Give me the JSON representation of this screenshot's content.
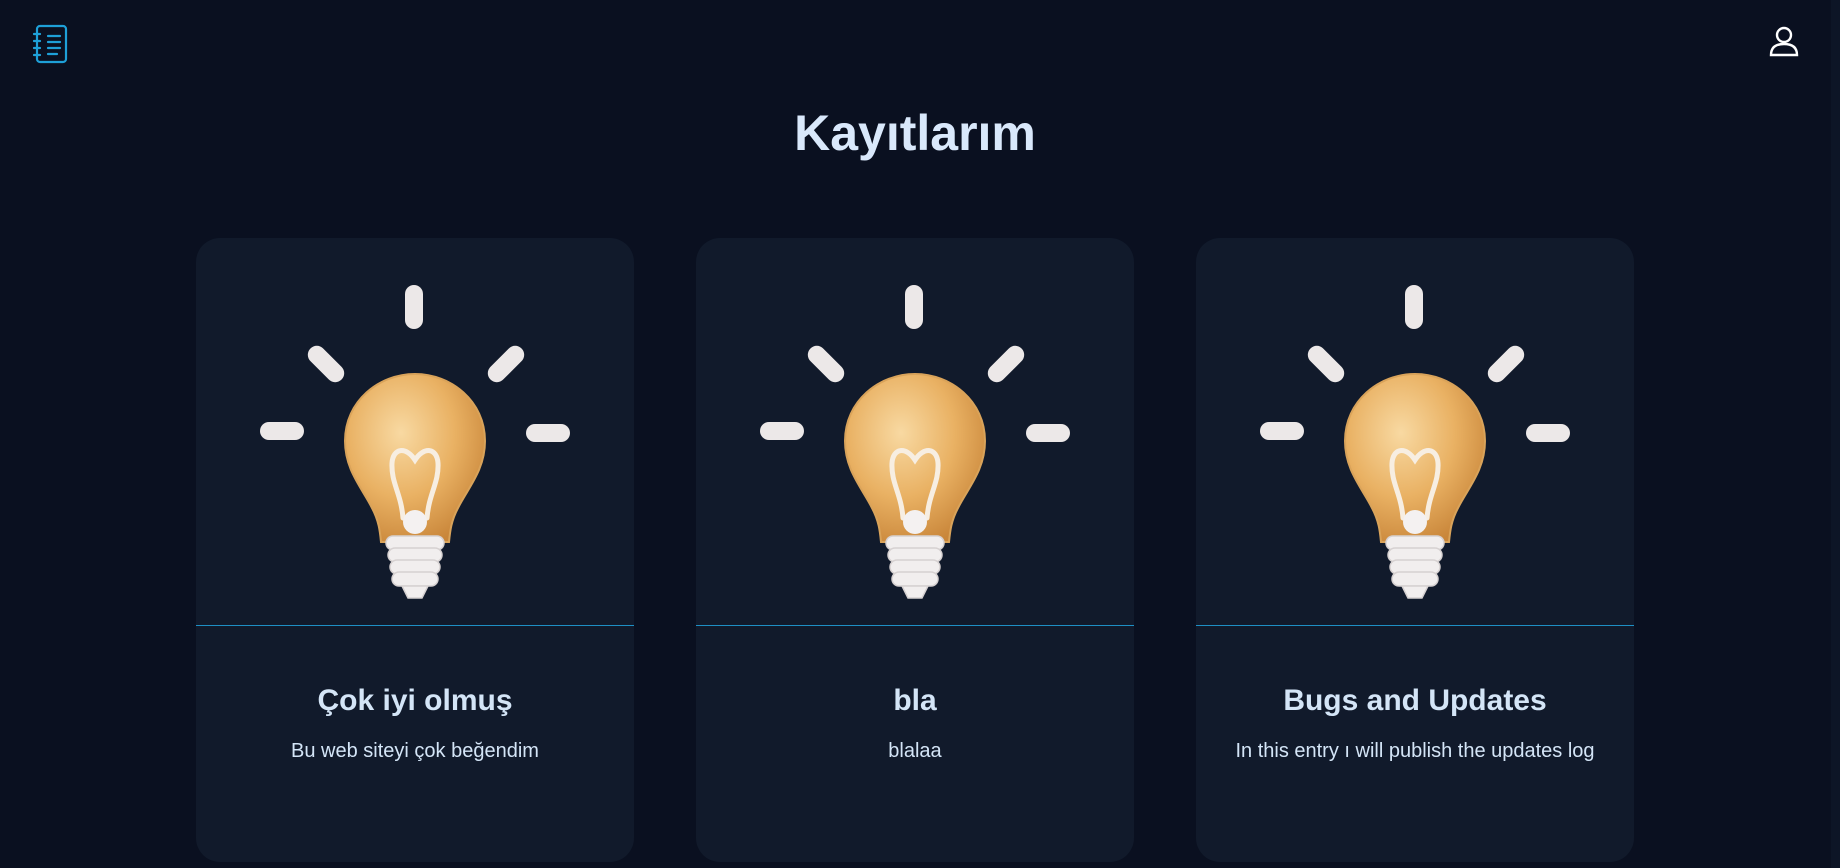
{
  "header": {
    "logo_icon": "notebook-list-icon",
    "profile_icon": "user-profile-icon",
    "accent_color": "#1ea0d8"
  },
  "page": {
    "title": "Kayıtlarım"
  },
  "cards": [
    {
      "illustration": "lightbulb-icon",
      "title": "Çok iyi olmuş",
      "text": "Bu web siteyi çok beğendim"
    },
    {
      "illustration": "lightbulb-icon",
      "title": "bla",
      "text": "blalaa"
    },
    {
      "illustration": "lightbulb-icon",
      "title": "Bugs and Updates",
      "text": "In this entry ı will publish the updates log"
    }
  ]
}
